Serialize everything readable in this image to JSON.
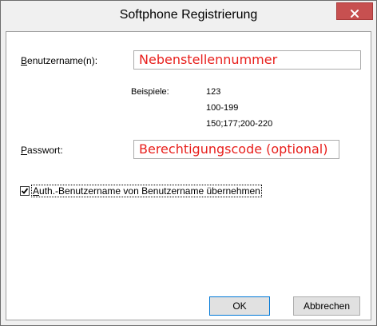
{
  "window": {
    "title": "Softphone Registrierung",
    "close_icon": "close-icon"
  },
  "form": {
    "username_label_underlined": "B",
    "username_label_rest": "enutzername(n):",
    "username_value": "Nebenstellennummer",
    "examples_label": "Beispiele:",
    "examples": [
      "123",
      "100-199",
      "150;177;200-220"
    ],
    "password_label_underlined": "P",
    "password_label_rest": "asswort:",
    "password_value": "Berechtigungscode (optional)",
    "checkbox_checked": true,
    "checkbox_label_underlined": "A",
    "checkbox_label_rest": "uth.-Benutzername von Benutzername übernehmen"
  },
  "buttons": {
    "ok_label": "OK",
    "cancel_label": "Abbrechen"
  },
  "colors": {
    "field_text": "#e8201d",
    "close_button": "#c75050",
    "default_button_border": "#0078d7"
  }
}
